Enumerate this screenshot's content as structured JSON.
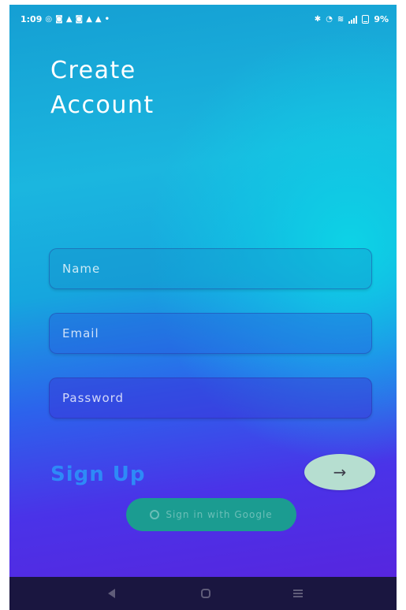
{
  "status_bar": {
    "time": "1:09",
    "left_icons": [
      "whatsapp-icon",
      "instagram-icon",
      "notification-bell-icon",
      "instagram-icon",
      "notification-bell-icon",
      "notification-bell-icon",
      "dot-icon"
    ],
    "right_icons": [
      "bluetooth-icon",
      "wifi-icon",
      "volte-icon",
      "signal-icon",
      "battery-icon"
    ],
    "battery": "9%"
  },
  "header": {
    "title_line1": "Create",
    "title_line2": "Account"
  },
  "form": {
    "name_placeholder": "Name",
    "email_placeholder": "Email",
    "password_placeholder": "Password"
  },
  "actions": {
    "signup_label": "Sign Up",
    "submit_icon": "arrow-right-icon",
    "google_label": "Sign in with Google"
  },
  "nav_bar": {
    "buttons": [
      "back-icon",
      "home-icon",
      "menu-icon"
    ]
  },
  "colors": {
    "gradient_top": "#159fd3",
    "gradient_bottom": "#5a22dc",
    "signup_text": "#2e8af7",
    "arrow_button": "#b6ded0",
    "google_button": "#1b9c91",
    "nav_bar": "#1a1640"
  }
}
